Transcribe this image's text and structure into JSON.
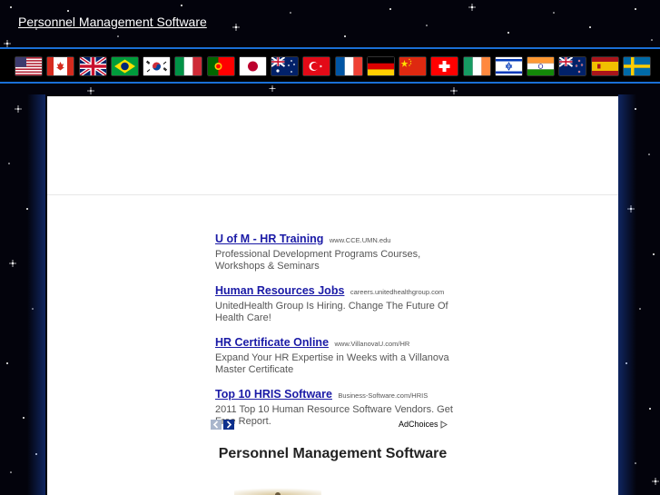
{
  "site": {
    "title": "Personnel Management Software"
  },
  "flags": [
    {
      "country": "United States",
      "icon": "us-flag-icon"
    },
    {
      "country": "Canada",
      "icon": "canada-flag-icon"
    },
    {
      "country": "United Kingdom",
      "icon": "uk-flag-icon"
    },
    {
      "country": "Brazil",
      "icon": "brazil-flag-icon"
    },
    {
      "country": "South Korea",
      "icon": "korea-flag-icon"
    },
    {
      "country": "Italy",
      "icon": "italy-flag-icon"
    },
    {
      "country": "Portugal",
      "icon": "portugal-flag-icon"
    },
    {
      "country": "Japan",
      "icon": "japan-flag-icon"
    },
    {
      "country": "Australia",
      "icon": "australia-flag-icon"
    },
    {
      "country": "Turkey",
      "icon": "turkey-flag-icon"
    },
    {
      "country": "France",
      "icon": "france-flag-icon"
    },
    {
      "country": "Germany",
      "icon": "germany-flag-icon"
    },
    {
      "country": "China",
      "icon": "china-flag-icon"
    },
    {
      "country": "Switzerland",
      "icon": "switzerland-flag-icon"
    },
    {
      "country": "Ireland",
      "icon": "ireland-flag-icon"
    },
    {
      "country": "Israel",
      "icon": "israel-flag-icon"
    },
    {
      "country": "India",
      "icon": "india-flag-icon"
    },
    {
      "country": "New Zealand",
      "icon": "new-zealand-flag-icon"
    },
    {
      "country": "Spain",
      "icon": "spain-flag-icon"
    },
    {
      "country": "Sweden",
      "icon": "sweden-flag-icon"
    }
  ],
  "ads": [
    {
      "title": "U of M - HR Training",
      "url": "www.CCE.UMN.edu",
      "desc": "Professional Development Programs Courses, Workshops & Seminars"
    },
    {
      "title": "Human Resources Jobs",
      "url": "careers.unitedhealthgroup.com",
      "desc": "UnitedHealth Group Is Hiring. Change The Future Of Health Care!"
    },
    {
      "title": "HR Certificate Online",
      "url": "www.VillanovaU.com/HR",
      "desc": "Expand Your HR Expertise in Weeks with a Villanova Master Certificate"
    },
    {
      "title": "Top 10 HRIS Software",
      "url": "Business-Software.com/HRIS",
      "desc": "2011 Top 10 Human Resource Software Vendors. Get Free Report."
    }
  ],
  "ad_nav": {
    "prev_icon": "chevron-left-icon",
    "next_icon": "chevron-right-icon"
  },
  "adchoices": {
    "label": "AdChoices",
    "icon": "adchoices-triangle-icon"
  },
  "page": {
    "heading": "Personnel Management Software"
  },
  "colors": {
    "background": "#03030c",
    "bar_border": "#1a6fd6",
    "ad_title": "#1a1aa6",
    "content_bg": "#ffffff"
  }
}
